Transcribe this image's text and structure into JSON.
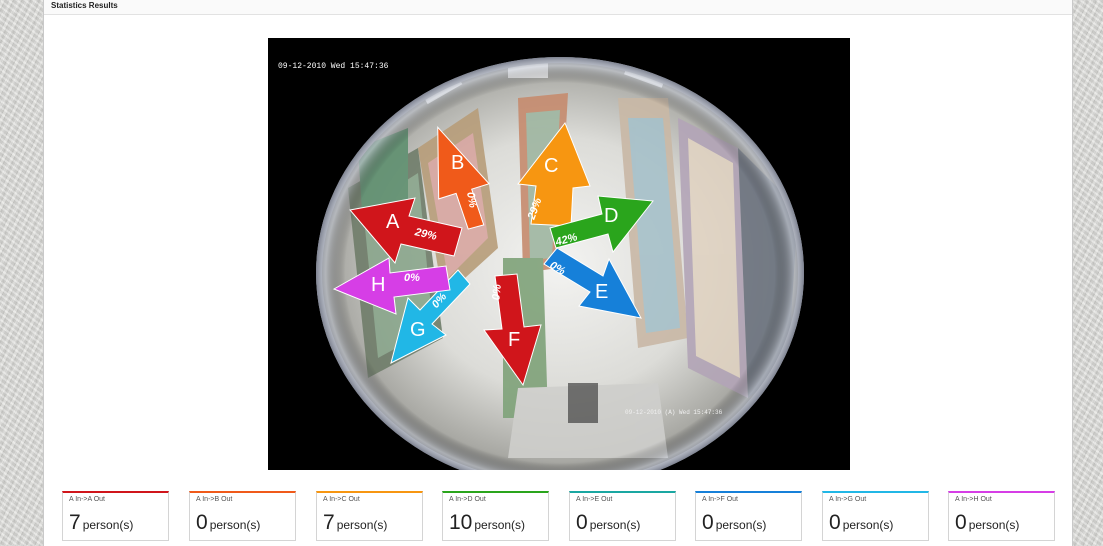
{
  "header": {
    "title": "Statistics Results"
  },
  "camera": {
    "timestamp": "09-12-2010 Wed 15:47:36",
    "corner_stamp": "09-12-2010 (A) Wed 15:47:36"
  },
  "directions": [
    {
      "letter": "A",
      "percent": "29%",
      "color": "#d0151b"
    },
    {
      "letter": "B",
      "percent": "0%",
      "color": "#f05a1a"
    },
    {
      "letter": "C",
      "percent": "29%",
      "color": "#f79611"
    },
    {
      "letter": "D",
      "percent": "42%",
      "color": "#2aa51c"
    },
    {
      "letter": "E",
      "percent": "0%",
      "color": "#1680d9"
    },
    {
      "letter": "F",
      "percent": "0%",
      "color": "#d0151b"
    },
    {
      "letter": "G",
      "percent": "0%",
      "color": "#21b7e6"
    },
    {
      "letter": "H",
      "percent": "0%",
      "color": "#d63ee6"
    }
  ],
  "stats": [
    {
      "label": "A In->A Out",
      "value": "7",
      "unit": "person(s)",
      "color": "#d0151b"
    },
    {
      "label": "A In->B Out",
      "value": "0",
      "unit": "person(s)",
      "color": "#f05a1a"
    },
    {
      "label": "A In->C Out",
      "value": "7",
      "unit": "person(s)",
      "color": "#f79611"
    },
    {
      "label": "A In->D Out",
      "value": "10",
      "unit": "person(s)",
      "color": "#2aa51c"
    },
    {
      "label": "A In->E Out",
      "value": "0",
      "unit": "person(s)",
      "color": "#1aa7a2"
    },
    {
      "label": "A In->F Out",
      "value": "0",
      "unit": "person(s)",
      "color": "#1680d9"
    },
    {
      "label": "A In->G Out",
      "value": "0",
      "unit": "person(s)",
      "color": "#21b7e6"
    },
    {
      "label": "A In->H Out",
      "value": "0",
      "unit": "person(s)",
      "color": "#d63ee6"
    }
  ]
}
